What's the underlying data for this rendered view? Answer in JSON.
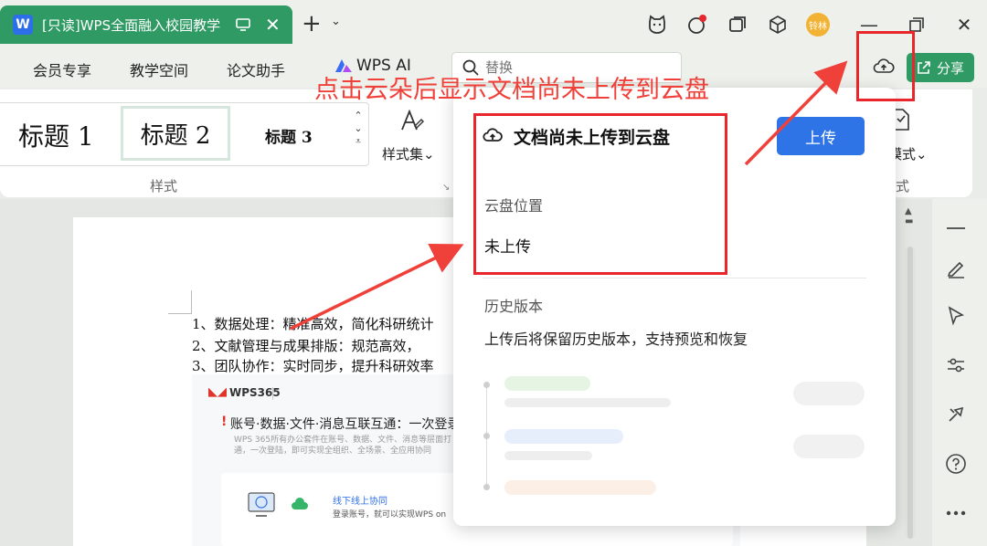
{
  "titlebar": {
    "tab_title": "[只读]WPS全面融入校园教学",
    "tab_close": "✕",
    "new_tab": "+",
    "new_tab_more": "⌄",
    "avatar_text": "铃林",
    "minimize": "—",
    "close": "✕"
  },
  "menu": {
    "items": [
      "会员专享",
      "教学空间",
      "论文助手"
    ],
    "wps_ai": "WPS AI",
    "search_placeholder": "替换",
    "share": "分享"
  },
  "ribbon": {
    "heading1": "标题 1",
    "heading2": "标题 2",
    "heading3": "标题 3",
    "style_set": "样式集⌄",
    "group_label": "样式",
    "mode_label": "模式⌄",
    "group_label2": "式"
  },
  "document": {
    "lines": [
      "1、数据处理：精准高效，简化科研统计",
      "2、文献管理与成果排版：规范高效，",
      "3、团队协作：实时同步，提升科研效率"
    ],
    "embed": {
      "logo": "WPS365",
      "title": "账号·数据·文件·消息互联互通：一次登录",
      "desc": "WPS 365所有办公套件在账号、数据、文件、消息等层面打通，一次登陆，即可实现全组织、全场景、全应用协同",
      "card_title": "线下线上协同",
      "card_desc": "登录账号，就可以实现WPS on"
    }
  },
  "popup": {
    "title": "文档尚未上传到云盘",
    "upload_button": "上传",
    "location_label": "云盘位置",
    "location_value": "未上传",
    "history_label": "历史版本",
    "history_desc": "上传后将保留历史版本，支持预览和恢复"
  },
  "annotation": {
    "text": "点击云朵后显示文档尚未上传到云盘"
  },
  "colors": {
    "accent_green": "#2f9a63",
    "upload_blue": "#2f74e6",
    "annotation_red": "#e8262b"
  }
}
